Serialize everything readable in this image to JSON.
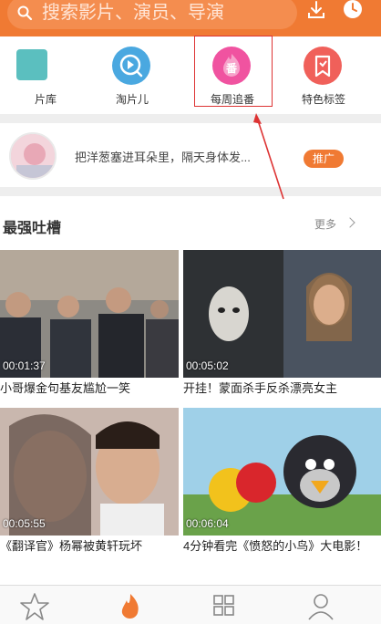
{
  "search": {
    "placeholder": "搜索影片、演员、导演"
  },
  "shortcuts": [
    {
      "label": "片库",
      "icon": "library-icon",
      "color": "#5bbfbf"
    },
    {
      "label": "淘片儿",
      "icon": "play-search-icon",
      "color": "#4aa8e0"
    },
    {
      "label": "每周追番",
      "icon": "anime-icon",
      "color": "#f053a0"
    },
    {
      "label": "特色标签",
      "icon": "bookmark-icon",
      "color": "#f0605a"
    }
  ],
  "promo": {
    "text": "把洋葱塞进耳朵里，隔天身体发...",
    "badge": "推广"
  },
  "section": {
    "title": "最强吐槽",
    "more": "更多"
  },
  "videos": [
    {
      "duration": "00:01:37",
      "title": "小哥爆金句基友尴尬一笑"
    },
    {
      "duration": "00:05:02",
      "title": "开挂！蒙面杀手反杀漂亮女主"
    },
    {
      "duration": "00:05:55",
      "title": "《翻译官》杨幂被黄轩玩坏"
    },
    {
      "duration": "00:06:04",
      "title": "4分钟看完《愤怒的小鸟》大电影！"
    }
  ],
  "tabs": [
    "favorite",
    "hot",
    "category",
    "profile"
  ],
  "colors": {
    "accent": "#f07a33",
    "highlight": "#d33333"
  }
}
